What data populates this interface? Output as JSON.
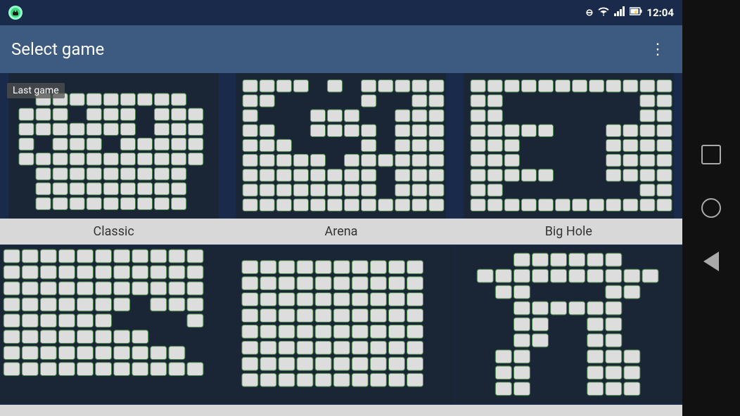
{
  "statusBar": {
    "time": "12:04",
    "icons": [
      "minus-circle",
      "wifi",
      "signal",
      "battery"
    ]
  },
  "appBar": {
    "title": "Select game",
    "moreButton": "⋮"
  },
  "games": [
    {
      "id": "classic",
      "label": "Classic",
      "isLastGame": true,
      "lastGameText": "Last game"
    },
    {
      "id": "arena",
      "label": "Arena",
      "isLastGame": false,
      "lastGameText": ""
    },
    {
      "id": "big-hole",
      "label": "Big Hole",
      "isLastGame": false,
      "lastGameText": ""
    },
    {
      "id": "spiral",
      "label": "",
      "isLastGame": false,
      "lastGameText": ""
    },
    {
      "id": "flat",
      "label": "",
      "isLastGame": false,
      "lastGameText": ""
    },
    {
      "id": "figure",
      "label": "",
      "isLastGame": false,
      "lastGameText": ""
    }
  ],
  "navBar": {
    "squareLabel": "recent-apps-button",
    "circleLabel": "home-button",
    "triangleLabel": "back-button"
  }
}
